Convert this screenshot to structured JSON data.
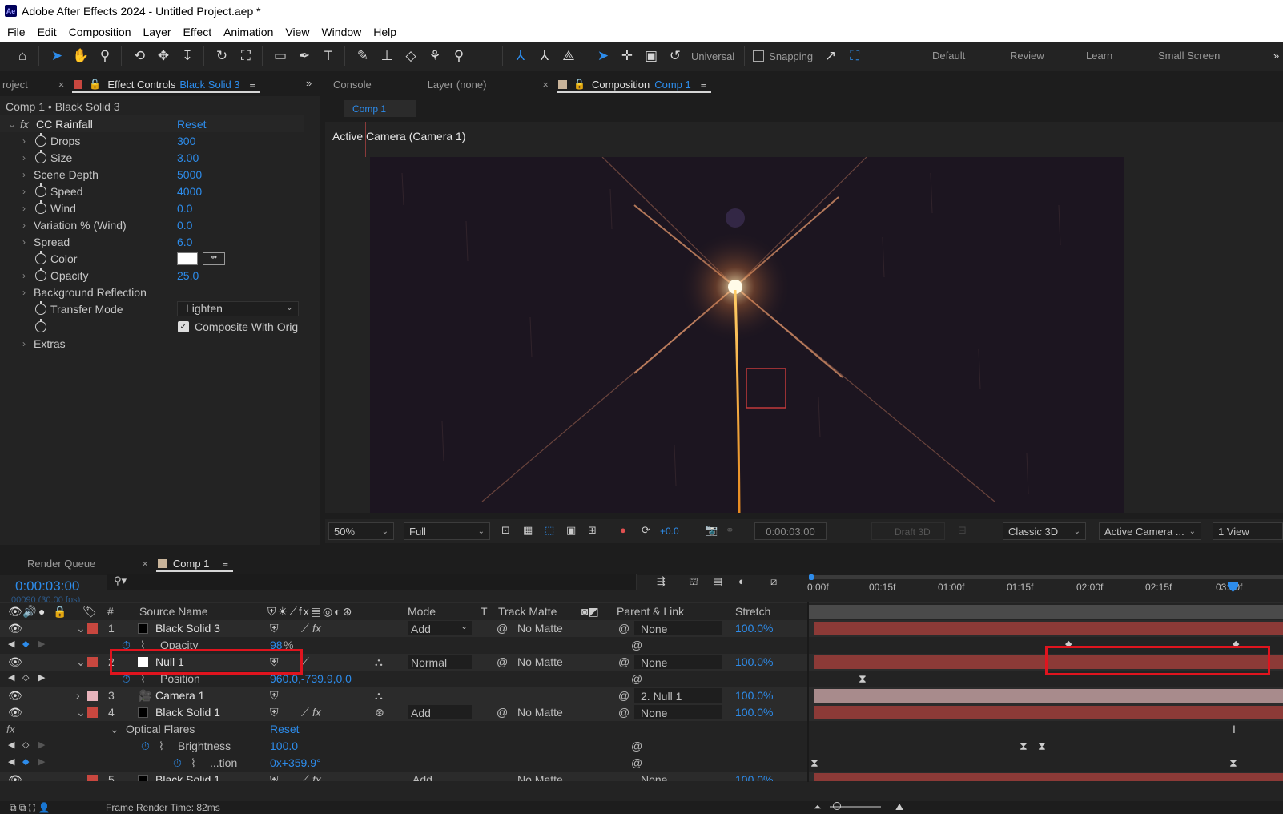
{
  "app": {
    "title": "Adobe After Effects 2024 - Untitled Project.aep *",
    "logo": "Ae"
  },
  "menu": [
    "File",
    "Edit",
    "Composition",
    "Layer",
    "Effect",
    "Animation",
    "View",
    "Window",
    "Help"
  ],
  "toolbar": {
    "universal": "Universal",
    "snapping": "Snapping",
    "workspaces": [
      "Default",
      "Review",
      "Learn",
      "Small Screen"
    ]
  },
  "left_panel": {
    "project_tab": "roject",
    "ec_tab_label": "Effect Controls",
    "ec_tab_layer": "Black Solid 3",
    "breadcrumb": "Comp 1 • Black Solid 3",
    "effect_name": "CC Rainfall",
    "reset": "Reset",
    "props": [
      {
        "name": "Drops",
        "value": "300"
      },
      {
        "name": "Size",
        "value": "3.00"
      },
      {
        "name": "Scene Depth",
        "value": "5000"
      },
      {
        "name": "Speed",
        "value": "4000"
      },
      {
        "name": "Wind",
        "value": "0.0"
      },
      {
        "name": "Variation % (Wind)",
        "value": "0.0"
      },
      {
        "name": "Spread",
        "value": "6.0"
      },
      {
        "name": "Color",
        "value": ""
      },
      {
        "name": "Opacity",
        "value": "25.0"
      },
      {
        "name": "Background Reflection",
        "value": ""
      },
      {
        "name": "Transfer Mode",
        "value": "Lighten"
      },
      {
        "name": "",
        "value": "Composite With Orig"
      },
      {
        "name": "Extras",
        "value": ""
      }
    ]
  },
  "viewer": {
    "tabs": {
      "console": "Console",
      "layer": "Layer (none)",
      "comp_label": "Composition",
      "comp_name": "Comp 1"
    },
    "comp_chip": "Comp 1",
    "camera_label": "Active Camera (Camera 1)",
    "zoom": "50%",
    "resolution": "Full",
    "exposure": "+0.0",
    "timecode": "0:00:03:00",
    "draft3d": "Draft 3D",
    "renderer": "Classic 3D",
    "view_camera": "Active Camera ...",
    "views": "1 View"
  },
  "timeline": {
    "tabs": {
      "render_queue": "Render Queue",
      "comp": "Comp 1"
    },
    "timecode": "0:00:03:00",
    "frames": "00090 (30.00 fps)",
    "search_placeholder": "",
    "headers": {
      "num": "#",
      "source": "Source Name",
      "mode": "Mode",
      "t": "T",
      "track_matte": "Track Matte",
      "parent": "Parent & Link",
      "stretch": "Stretch"
    },
    "ruler": [
      "0:00f",
      "00:15f",
      "01:00f",
      "01:15f",
      "02:00f",
      "02:15f",
      "03:00f"
    ],
    "layers": {
      "l1": {
        "num": "1",
        "name": "Black Solid 3",
        "mode": "Add",
        "matte": "No Matte",
        "parent": "None",
        "stretch": "100.0%"
      },
      "l1_opacity": {
        "name": "Opacity",
        "value": "98",
        "unit": "%"
      },
      "l2": {
        "num": "2",
        "name": "Null 1",
        "mode": "Normal",
        "matte": "No Matte",
        "parent": "None",
        "stretch": "100.0%"
      },
      "l2_position": {
        "name": "Position",
        "value": "960.0,-739.9,0.0"
      },
      "l3": {
        "num": "3",
        "name": "Camera 1",
        "parent": "2. Null 1",
        "stretch": "100.0%"
      },
      "l4": {
        "num": "4",
        "name": "Black Solid 1",
        "mode": "Add",
        "matte": "No Matte",
        "parent": "None",
        "stretch": "100.0%"
      },
      "l4_effect": {
        "name": "Optical Flares",
        "reset": "Reset"
      },
      "l4_brightness": {
        "name": "Brightness",
        "value": "100.0"
      },
      "l4_rotation": {
        "name": "...tion",
        "value": "0x+359.9°"
      },
      "l5": {
        "num": "5",
        "name": "Black Solid 1",
        "mode": "Add",
        "matte": "No Matte",
        "parent": "None",
        "stretch": "100.0%"
      }
    },
    "status": "Frame Render Time: 82ms"
  },
  "colors": {
    "accent": "#2d8ceb",
    "label_red": "#c8473f",
    "highlight": "#e0141e",
    "bar_red": "#8c3a37",
    "bar_pink": "#a88b8c"
  }
}
